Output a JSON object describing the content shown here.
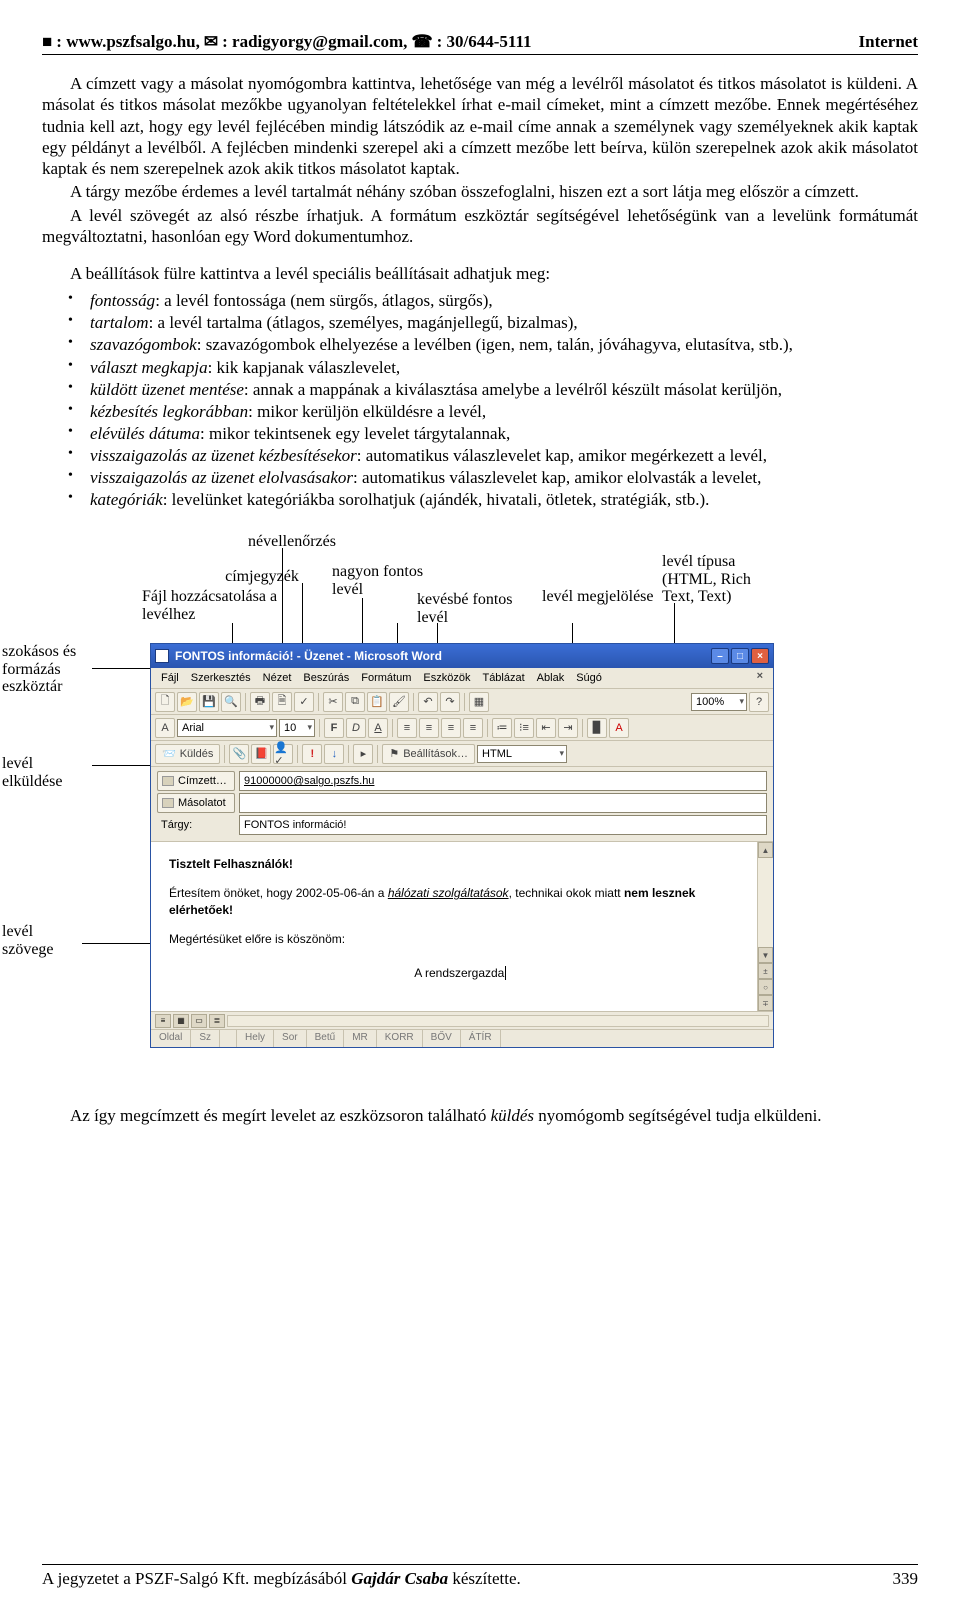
{
  "header": {
    "web_icon": "■",
    "web": ": www.pszfsalgo.hu, ",
    "mail_icon": "✉",
    "mail": ": radigyorgy@gmail.com, ",
    "phone_icon": "☎",
    "phone": ": 30/644-5111",
    "right": "Internet"
  },
  "p1": "A címzett vagy a másolat nyomógombra kattintva, lehetősége van még a levélről másolatot és titkos másolatot is küldeni. A másolat és titkos másolat mezőkbe ugyanolyan feltételekkel írhat e-mail címeket, mint a címzett mezőbe. Ennek megértéséhez tudnia kell azt, hogy egy levél fejlécében mindig látszódik az e-mail címe annak a személynek vagy személyeknek akik kaptak egy példányt a levélből. A fejlécben mindenki szerepel aki a címzett mezőbe lett beírva, külön szerepelnek azok akik másolatot kaptak és nem szerepelnek azok akik titkos másolatot kaptak.",
  "p2": "A tárgy mezőbe érdemes a levél tartalmát néhány szóban összefoglalni, hiszen ezt a sort látja meg először a címzett.",
  "p3": "A levél szövegét az alsó részbe írhatjuk. A formátum eszköztár segítségével lehetőségünk van a levelünk formátumát megváltoztatni, hasonlóan egy Word dokumentumhoz.",
  "p4": "A beállítások fülre kattintva a levél speciális beállításait adhatjuk meg:",
  "bullets": [
    {
      "it": "fontosság",
      "rest": ": a levél fontossága (nem sürgős, átlagos, sürgős),"
    },
    {
      "it": "tartalom",
      "rest": ": a levél tartalma (átlagos, személyes, magánjellegű, bizalmas),"
    },
    {
      "it": "szavazógombok",
      "rest": ": szavazógombok elhelyezése a levélben (igen, nem, talán, jóváhagyva, elutasítva, stb.),"
    },
    {
      "it": "választ megkapja",
      "rest": ": kik kapjanak válaszlevelet,"
    },
    {
      "it": "küldött üzenet mentése",
      "rest": ": annak a mappának a kiválasztása amelybe a levélről készült másolat kerüljön,"
    },
    {
      "it": "kézbesítés legkorábban",
      "rest": ": mikor kerüljön elküldésre a levél,"
    },
    {
      "it": "elévülés dátuma",
      "rest": ": mikor tekintsenek egy levelet tárgytalannak,"
    },
    {
      "it": "visszaigazolás az üzenet kézbesítésekor",
      "rest": ": automatikus válaszlevelet kap, amikor megérkezett a levél,"
    },
    {
      "it": "visszaigazolás az üzenet elolvasásakor",
      "rest": ": automatikus válaszlevelet kap, amikor elolvasták a levelet,"
    },
    {
      "it": "kategóriák",
      "rest": ": levelünket kategóriákba sorolhatjuk (ajándék, hivatali, ötletek, stratégiák, stb.)."
    }
  ],
  "callouts": {
    "toolbar": "szokásos és formázás eszköztár",
    "send": "levél elküldése",
    "body": "levél szövege",
    "attach": "Fájl hozzácsatolása a levélhez",
    "spell": "névellenőrzés",
    "addrbook": "címjegyzék",
    "high": "nagyon fontos levél",
    "low": "kevésbé fontos levél",
    "options": "levél megjelölése",
    "format": "levél típusa (HTML, Rich Text, Text)"
  },
  "win": {
    "title": "FONTOS információ! - Üzenet - Microsoft Word",
    "menu": [
      "Fájl",
      "Szerkesztés",
      "Nézet",
      "Beszúrás",
      "Formátum",
      "Eszközök",
      "Táblázat",
      "Ablak",
      "Súgó"
    ],
    "zoom": "100%",
    "font": "Arial",
    "size": "10",
    "send": "Küldés",
    "options": "Beállítások…",
    "htmlfmt": "HTML",
    "to_btn": "Címzett…",
    "to_val": "91000000@salgo.pszfs.hu",
    "cc_btn": "Másolatot",
    "cc_val": "",
    "subj_lbl": "Tárgy:",
    "subj_val": "FONTOS információ!",
    "body_greet": "Tisztelt Felhasználók!",
    "body_p_a": "Értesítem önöket, hogy 2002-05-06-án a ",
    "body_p_it": "hálózati szolgáltatások",
    "body_p_b": ", technikai okok miatt ",
    "body_p_bold": "nem lesznek elérhetőek!",
    "body_p2": "Megértésüket előre is köszönöm:",
    "body_sig": "A rendszergazda",
    "status": [
      "Oldal",
      "Sz",
      "",
      "Hely",
      "Sor",
      "Betű",
      "MR",
      "KORR",
      "BŐV",
      "ÁTÍR"
    ]
  },
  "p_after_a": "Az így megcímzett és megírt levelet az eszközsoron található ",
  "p_after_it": "küldés",
  "p_after_b": " nyomógomb segítségével tudja elküldeni.",
  "footer": {
    "left_a": "A jegyzetet a PSZF-Salgó Kft. megbízásából ",
    "left_b": "Gajdár Csaba",
    "left_c": " készítette.",
    "page": "339"
  }
}
